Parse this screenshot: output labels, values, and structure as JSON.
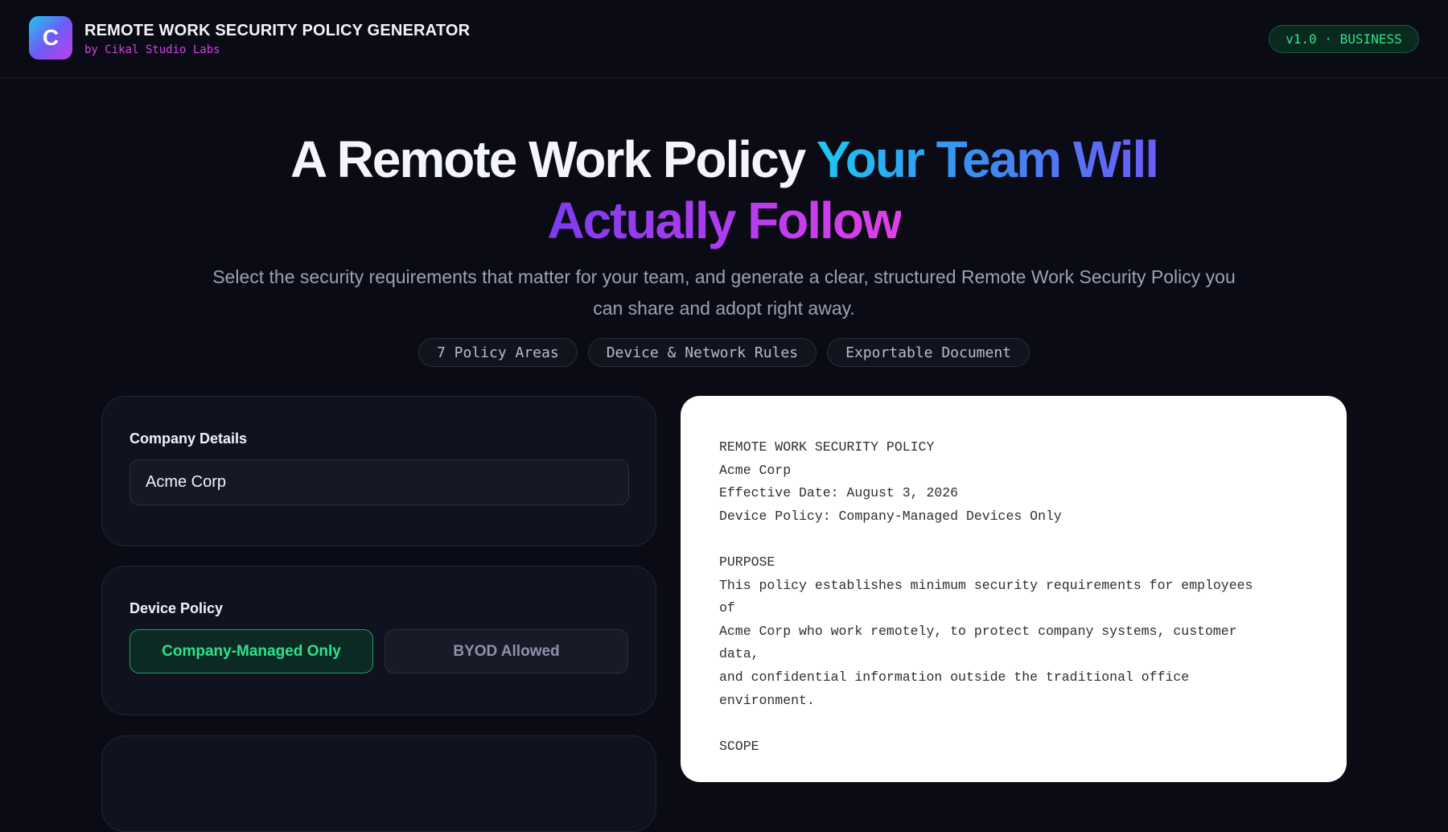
{
  "header": {
    "logo_letter": "C",
    "title": "REMOTE WORK SECURITY POLICY GENERATOR",
    "subtitle": "by Cikal Studio Labs",
    "version_badge": "v1.0 · BUSINESS"
  },
  "hero": {
    "title_part1": "A Remote Work Policy ",
    "title_part2": "Your Team Will",
    "title_part3": "Actually Follow",
    "description": "Select the security requirements that matter for your team, and generate a clear, structured Remote Work Security Policy you can share and adopt right away.",
    "pills": [
      "7 Policy Areas",
      "Device & Network Rules",
      "Exportable Document"
    ]
  },
  "company_details": {
    "label": "Company Details",
    "company_name_value": "Acme Corp"
  },
  "device_policy": {
    "label": "Device Policy",
    "options": [
      "Company-Managed Only",
      "BYOD Allowed"
    ],
    "selected": "Company-Managed Only"
  },
  "document": {
    "lines": [
      "REMOTE WORK SECURITY POLICY",
      "Acme Corp",
      "Effective Date: August 3, 2026",
      "Device Policy: Company-Managed Devices Only",
      "",
      "PURPOSE",
      "This policy establishes minimum security requirements for employees",
      "of",
      "Acme Corp who work remotely, to protect company systems, customer",
      "data,",
      "and confidential information outside the traditional office",
      "environment.",
      "",
      "SCOPE"
    ]
  },
  "colors": {
    "background": "#0a0b14",
    "accent_green": "#2fe18a",
    "accent_magenta": "#d142e6",
    "gradient_cyan": "#1cc8f2",
    "gradient_violet": "#6b5cf6",
    "gradient_pink": "#e040e6"
  }
}
